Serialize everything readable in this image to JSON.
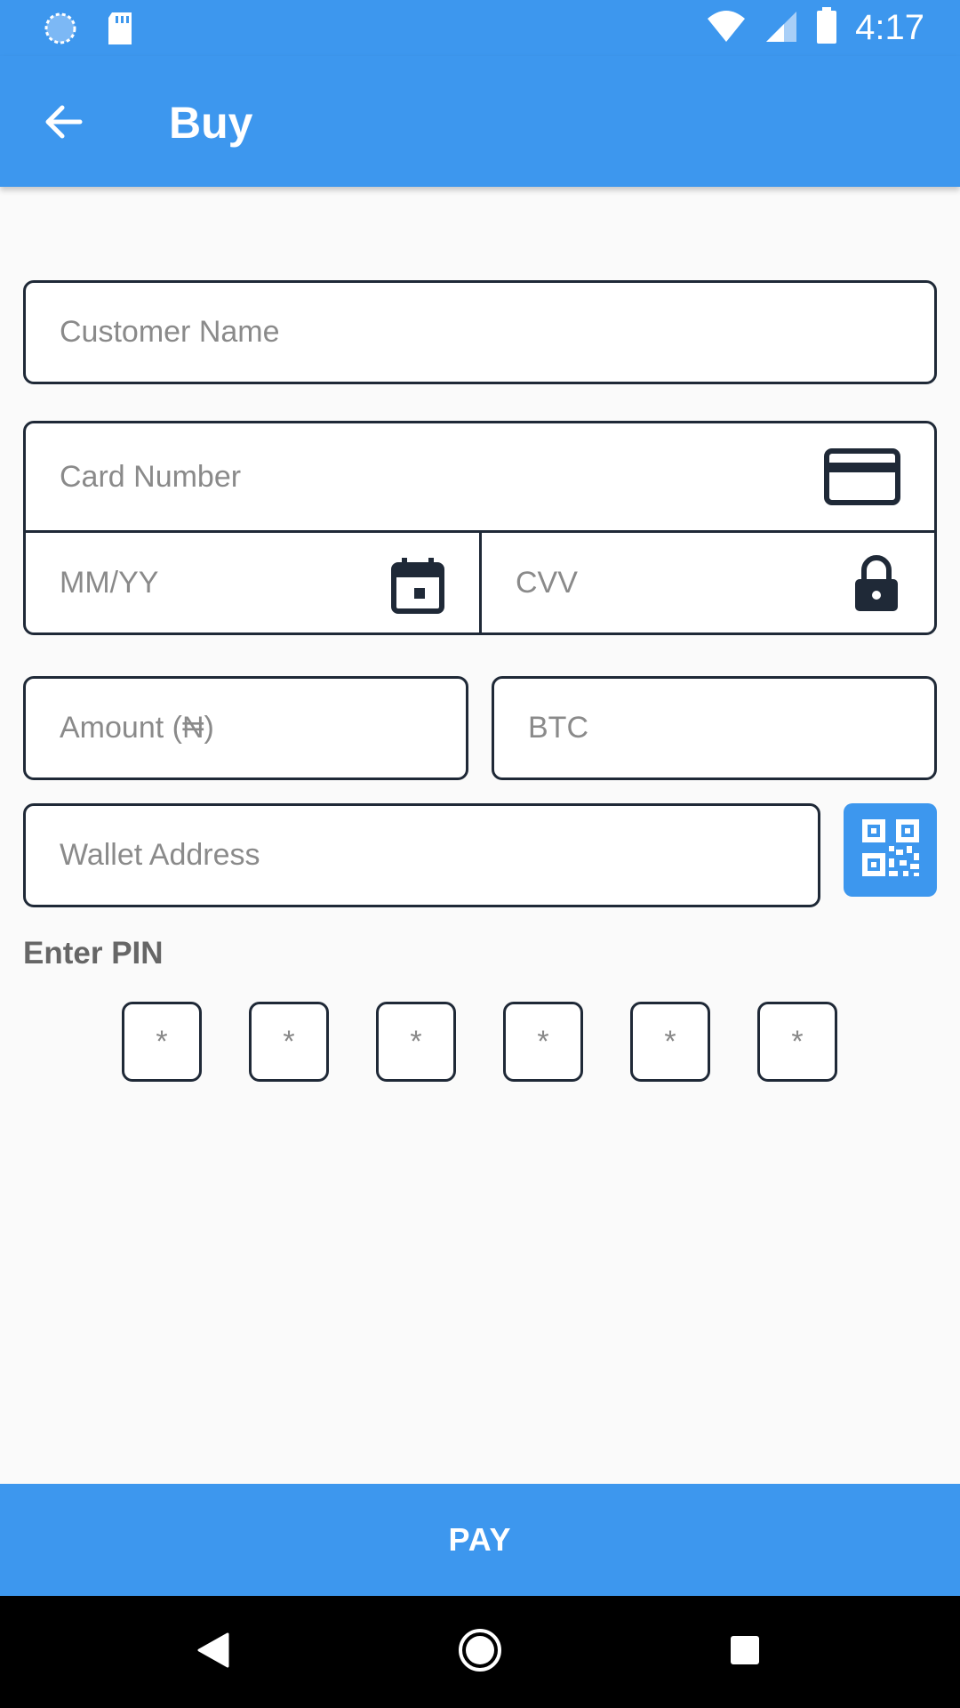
{
  "status_bar": {
    "time": "4:17",
    "icons_left": [
      "sync-icon",
      "sd-card-icon"
    ],
    "icons_right": [
      "wifi-icon",
      "signal-icon",
      "battery-icon"
    ]
  },
  "app_bar": {
    "title": "Buy",
    "back_icon": "arrow-back-icon"
  },
  "form": {
    "customer_name": {
      "placeholder": "Customer Name"
    },
    "card_number": {
      "placeholder": "Card Number",
      "icon": "credit-card-icon"
    },
    "expiry": {
      "placeholder": "MM/YY",
      "icon": "calendar-icon"
    },
    "cvv": {
      "placeholder": "CVV",
      "icon": "lock-icon"
    },
    "amount": {
      "placeholder": "Amount (₦)"
    },
    "btc": {
      "placeholder": "BTC"
    },
    "wallet_address": {
      "placeholder": "Wallet Address"
    },
    "qr_button_icon": "qr-code-icon"
  },
  "pin": {
    "label": "Enter PIN",
    "boxes": [
      "*",
      "*",
      "*",
      "*",
      "*",
      "*"
    ]
  },
  "pay_button": {
    "label": "PAY"
  },
  "colors": {
    "primary": "#3d97ee",
    "border": "#1f2937",
    "background": "#fafafa"
  },
  "nav": [
    "back-nav-icon",
    "home-nav-icon",
    "recents-nav-icon"
  ]
}
